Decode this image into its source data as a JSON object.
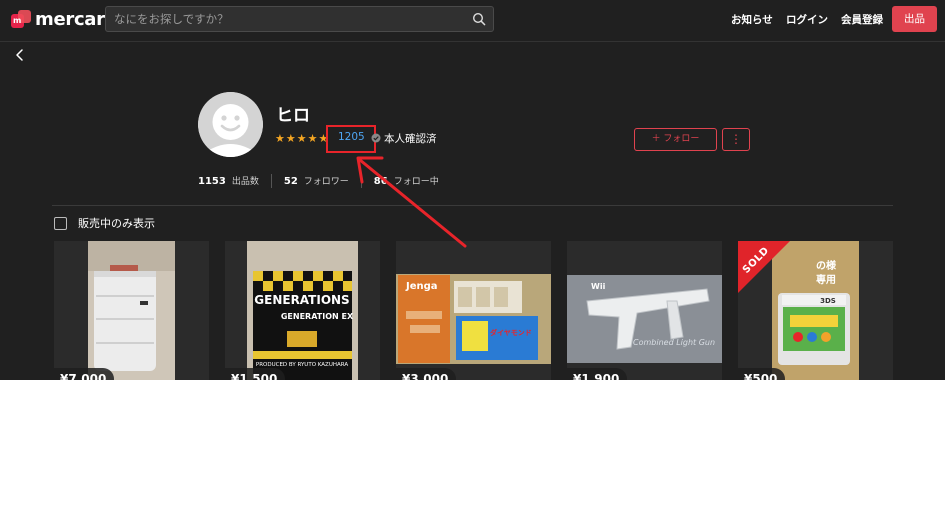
{
  "header": {
    "logo_text": "mercari",
    "logo_mark_letter": "m",
    "search_placeholder": "なにをお探しですか？",
    "nav": {
      "notifications": "お知らせ",
      "login": "ログイン",
      "register": "会員登録",
      "sell": "出品"
    }
  },
  "profile": {
    "name": "ヒロ",
    "stars": [
      "★",
      "★",
      "★",
      "★",
      "★"
    ],
    "rating_count": "1205",
    "verified_label": "本人確認済",
    "follow_button": "＋ フォロー",
    "more_button": "⋮",
    "stats": [
      {
        "value": "1153",
        "label": "出品数"
      },
      {
        "value": "52",
        "label": "フォロワー"
      },
      {
        "value": "86",
        "label": "フォロー中"
      }
    ]
  },
  "filter": {
    "label": "販売中のみ表示"
  },
  "items": [
    {
      "price": "¥7,000",
      "sold": false
    },
    {
      "price": "¥1,500",
      "sold": false,
      "image_text_1": "GENERATIONS",
      "image_text_2": "GENERATION EX",
      "image_text_3": "PRODUCED BY RYUTO KAZUHARA"
    },
    {
      "price": "¥3,000",
      "sold": false,
      "image_text_1": "Jenga",
      "image_text_2": "ダイヤモンド"
    },
    {
      "price": "¥1,900",
      "sold": false,
      "image_text_1": "Wii",
      "image_text_2": "Combined Light Gun"
    },
    {
      "price": "¥500",
      "sold": true,
      "sold_label": "SOLD",
      "image_text_1": "の様",
      "image_text_2": "専用",
      "image_text_3": "3DS"
    }
  ],
  "colors": {
    "background": "#202020",
    "accent": "#e0434f",
    "star": "#f5a623",
    "rating_link": "#4ea5f2",
    "annotation": "#e8242a"
  },
  "icons": [
    "search-icon",
    "back-arrow-icon",
    "avatar-icon",
    "verified-icon",
    "more-dots-icon"
  ]
}
